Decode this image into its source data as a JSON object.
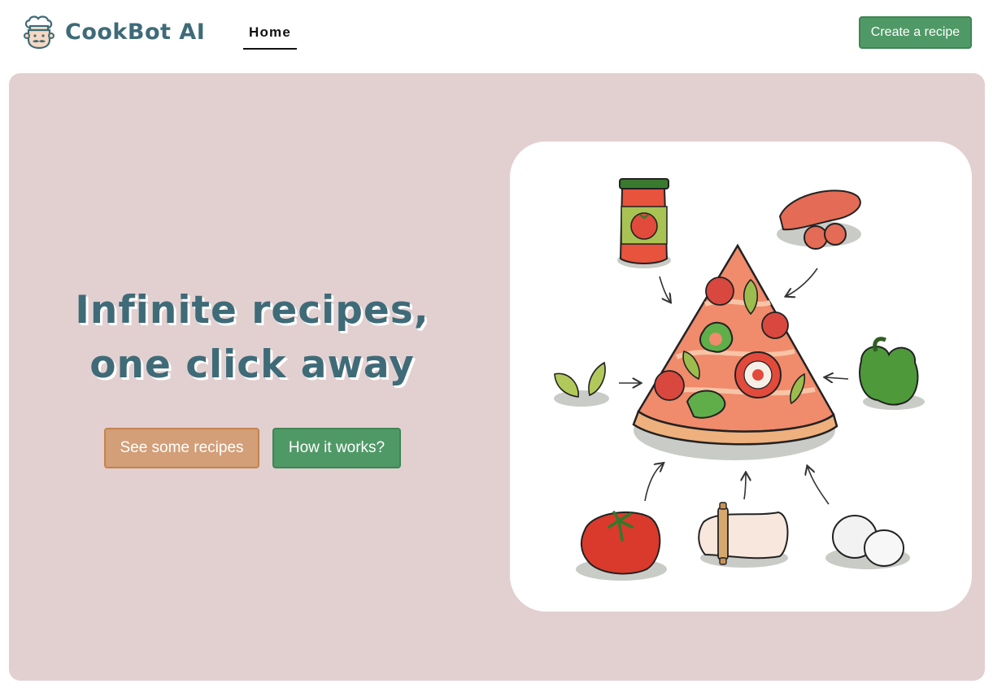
{
  "header": {
    "brand_name": "CookBot AI",
    "logo_icon": "chef-hat-icon",
    "nav": {
      "home_label": "Home"
    },
    "create_button_label": "Create a recipe"
  },
  "hero": {
    "title_line1": "Infinite recipes,",
    "title_line2": "one click away",
    "primary_button_label": "See some recipes",
    "secondary_button_label": "How it works?",
    "illustration_icon": "pizza-ingredients-illustration"
  },
  "colors": {
    "brand_teal": "#3f6b78",
    "hero_background": "#e2d0d1",
    "green_button": "#4f9966",
    "tan_button": "#d39f78"
  }
}
